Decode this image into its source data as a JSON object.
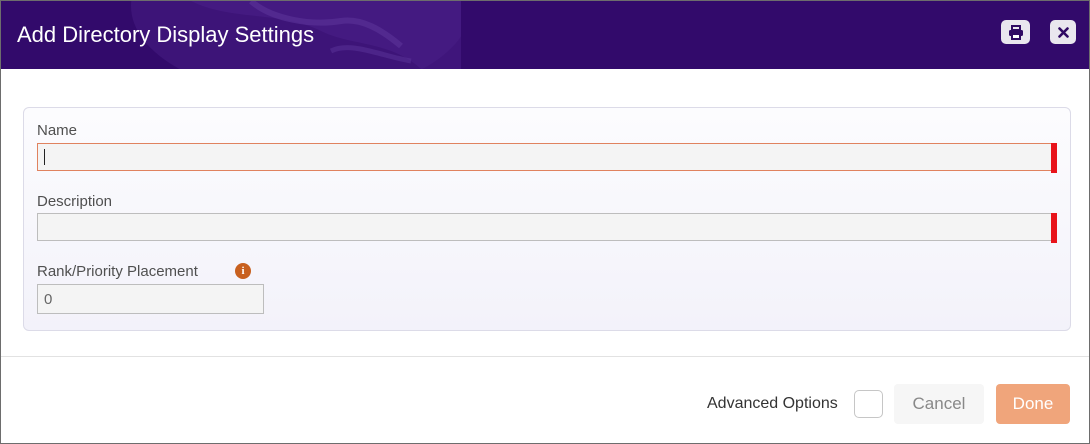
{
  "dialog": {
    "title": "Add Directory Display Settings",
    "print_icon": "print-icon",
    "close_icon": "close-icon"
  },
  "form": {
    "name_label": "Name",
    "name_value": "",
    "description_label": "Description",
    "description_value": "",
    "rank_label": "Rank/Priority Placement",
    "rank_info_icon": "info-icon",
    "rank_value": "0"
  },
  "footer": {
    "advanced_label": "Advanced Options",
    "cancel_label": "Cancel",
    "done_label": "Done"
  },
  "colors": {
    "header": "#320a6b",
    "required_marker": "#e8141b",
    "done_button": "#f0a57b",
    "info_icon": "#c8601f"
  }
}
